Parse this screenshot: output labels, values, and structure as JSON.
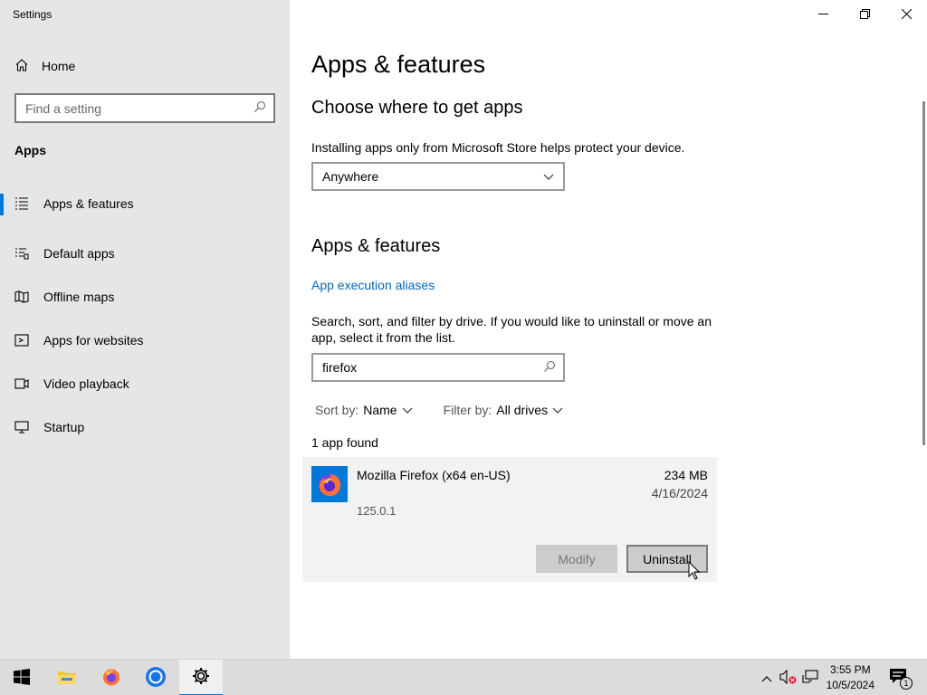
{
  "window": {
    "title": "Settings",
    "controls": {
      "minimize": "minimize-icon",
      "restore": "restore-icon",
      "close": "close-icon"
    }
  },
  "sidebar": {
    "home_label": "Home",
    "search_placeholder": "Find a setting",
    "section_label": "Apps",
    "items": [
      {
        "label": "Apps & features",
        "icon": "list-icon",
        "active": true
      },
      {
        "label": "Default apps",
        "icon": "default-apps-icon",
        "active": false
      },
      {
        "label": "Offline maps",
        "icon": "map-icon",
        "active": false
      },
      {
        "label": "Apps for websites",
        "icon": "website-icon",
        "active": false
      },
      {
        "label": "Video playback",
        "icon": "video-icon",
        "active": false
      },
      {
        "label": "Startup",
        "icon": "startup-icon",
        "active": false
      }
    ]
  },
  "main": {
    "page_title": "Apps & features",
    "choose_heading": "Choose where to get apps",
    "choose_desc": "Installing apps only from Microsoft Store helps protect your device.",
    "source_select_value": "Anywhere",
    "apps_heading": "Apps & features",
    "aliases_link": "App execution aliases",
    "search_desc": "Search, sort, and filter by drive. If you would like to uninstall or move an app, select it from the list.",
    "filter_value": "firefox",
    "sort_label": "Sort by:",
    "sort_value": "Name",
    "filter_label": "Filter by:",
    "filter_drive_value": "All drives",
    "result_count": "1 app found",
    "app": {
      "name": "Mozilla Firefox (x64 en-US)",
      "size": "234 MB",
      "date": "4/16/2024",
      "version": "125.0.1",
      "modify_label": "Modify",
      "uninstall_label": "Uninstall"
    }
  },
  "taskbar": {
    "items": [
      "start-icon",
      "file-explorer-icon",
      "firefox-icon",
      "chrome-icon",
      "settings-icon"
    ],
    "time": "3:55 PM",
    "date": "10/5/2024",
    "notification_count": "1"
  },
  "colors": {
    "accent": "#0078d7",
    "link": "#0067b8",
    "sidebar_bg": "#e6e6e6"
  }
}
